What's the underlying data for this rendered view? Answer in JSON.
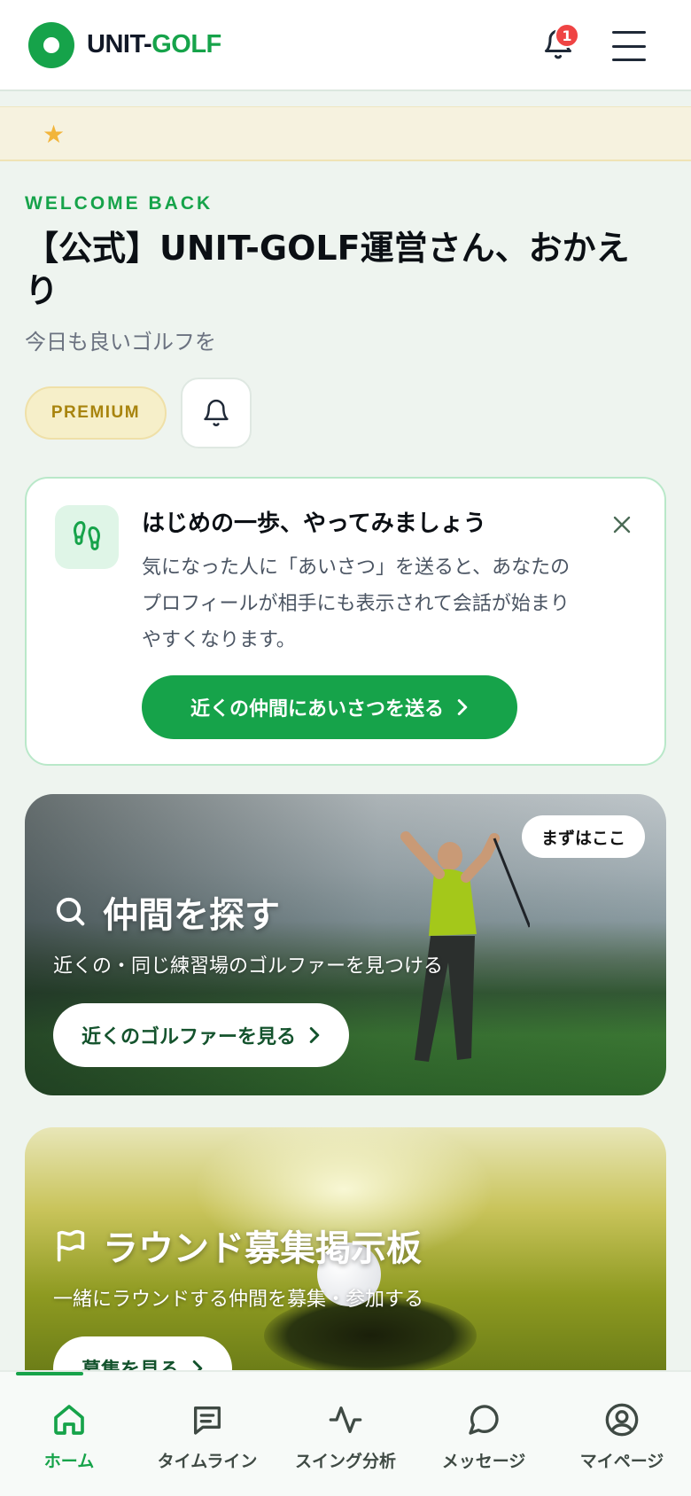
{
  "header": {
    "logo_part1": "UNIT-",
    "logo_part2": "GOLF",
    "notification_count": "1"
  },
  "welcome": {
    "kicker": "WELCOME BACK",
    "title": "【公式】UNIT-GOLF運営さん、おかえり",
    "subtitle": "今日も良いゴルフを",
    "premium_label": "PREMIUM"
  },
  "onboarding": {
    "title": "はじめの一歩、やってみましょう",
    "body": "気になった人に「あいさつ」を送ると、あなたのプロフィールが相手にも表示されて会話が始まりやすくなります。",
    "cta": "近くの仲間にあいさつを送る"
  },
  "card_find": {
    "tag": "まずはここ",
    "title": "仲間を探す",
    "subtitle": "近くの・同じ練習場のゴルファーを見つける",
    "button": "近くのゴルファーを見る"
  },
  "card_round": {
    "title": "ラウンド募集掲示板",
    "subtitle": "一緒にラウンドする仲間を募集・参加する",
    "button": "募集を見る"
  },
  "bottom_nav": {
    "items": [
      {
        "label": "ホーム",
        "icon": "home-icon",
        "active": true
      },
      {
        "label": "タイムライン",
        "icon": "timeline-icon",
        "active": false
      },
      {
        "label": "スイング分析",
        "icon": "activity-icon",
        "active": false
      },
      {
        "label": "メッセージ",
        "icon": "chat-icon",
        "active": false
      },
      {
        "label": "マイページ",
        "icon": "user-circle-icon",
        "active": false
      }
    ]
  },
  "colors": {
    "brand_green": "#16a34a",
    "badge_red": "#ef4444",
    "premium_gold": "#a8840e"
  }
}
